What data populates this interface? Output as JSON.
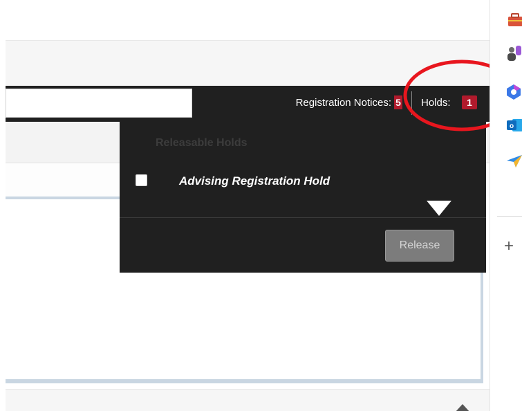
{
  "header": {
    "search_value": "",
    "registration_notices_label": "Registration Notices:",
    "registration_notices_count": "5",
    "holds_label": "Holds:",
    "holds_count": "1"
  },
  "holds_dropdown": {
    "heading": "Releasable Holds",
    "items": [
      {
        "label": "Advising Registration Hold",
        "checked": false
      }
    ],
    "release_button": "Release"
  },
  "annotation": {
    "highlight": "circle around Holds",
    "color": "#e8161e"
  },
  "side_rail": {
    "icons": [
      "briefcase-icon",
      "people-icon",
      "copilot-icon",
      "outlook-icon",
      "send-icon"
    ],
    "add_icon": "plus-icon"
  },
  "colors": {
    "header_bg": "#202020",
    "badge": "#b01a2c",
    "panel_border": "#c9d6e2"
  }
}
